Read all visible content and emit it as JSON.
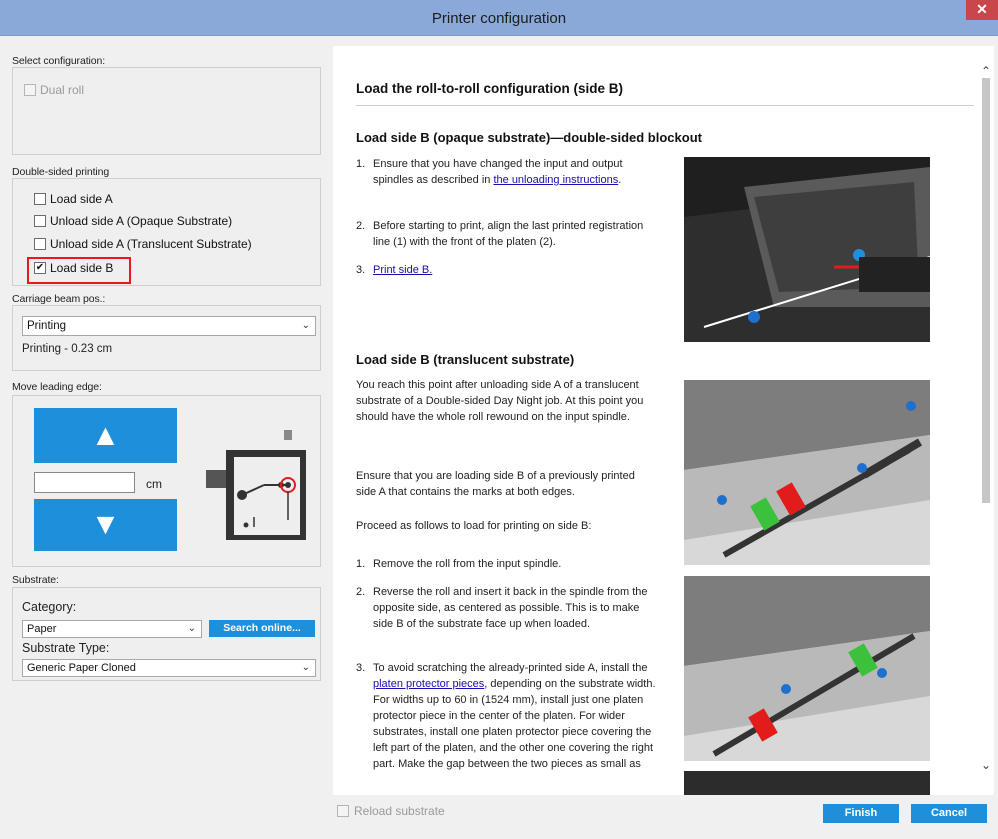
{
  "window": {
    "title": "Printer configuration",
    "close": "✕"
  },
  "left": {
    "select_configuration": {
      "label": "Select configuration:",
      "dual_roll": "Dual roll"
    },
    "double_sided": {
      "label": "Double-sided printing",
      "options": [
        {
          "label": "Load side A",
          "checked": false
        },
        {
          "label": "Unload side A (Opaque Substrate)",
          "checked": false
        },
        {
          "label": "Unload side A (Translucent Substrate)",
          "checked": false
        },
        {
          "label": "Load side B",
          "checked": true
        }
      ]
    },
    "carriage": {
      "label": "Carriage beam pos.:",
      "selected": "Printing",
      "status": "Printing - 0.23 cm"
    },
    "move_leading_edge": {
      "label": "Move leading edge:",
      "unit": "cm",
      "value": ""
    },
    "substrate": {
      "label": "Substrate:",
      "category_label": "Category:",
      "category_value": "Paper",
      "search_button": "Search online...",
      "type_label": "Substrate Type:",
      "type_value": "Generic Paper Cloned"
    }
  },
  "content": {
    "heading": "Load the roll-to-roll configuration (side B)",
    "opaque": {
      "heading": "Load side B (opaque substrate)—double-sided blockout",
      "steps": [
        {
          "n": "1.",
          "before": "Ensure that you have changed the input and output spindles as described in ",
          "link": "the unloading instructions",
          "after": "."
        },
        {
          "n": "2.",
          "text": "Before starting to print, align the last printed registration line (1) with the front of the platen (2)."
        },
        {
          "n": "3.",
          "link": "Print side B."
        }
      ]
    },
    "translucent": {
      "heading": "Load side B (translucent substrate)",
      "p1": "You reach this point after unloading side A of a translucent substrate of a Double-sided Day Night job. At this point you should have the whole roll rewound on the input spindle.",
      "p2": "Ensure that you are loading side B of a previously printed side A that contains the marks at both edges.",
      "p3": "Proceed as follows to load for printing on side B:",
      "steps": [
        {
          "n": "1.",
          "text": "Remove the roll from the input spindle."
        },
        {
          "n": "2.",
          "text": "Reverse the roll and insert it back in the spindle from the opposite side, as centered as possible. This is to make side B of the substrate face up when loaded."
        },
        {
          "n": "3.",
          "before": "To avoid scratching the already-printed side A, install the ",
          "link": "platen protector pieces",
          "after": ", depending on the substrate width. For widths up to 60 in (1524 mm), install just one platen protector piece in the center of the platen. For wider substrates, install one platen protector piece covering the left part of the platen, and the other one covering the right part. Make the gap between the two pieces as small as"
        }
      ]
    }
  },
  "footer": {
    "reload_label": "Reload substrate",
    "finish": "Finish",
    "cancel": "Cancel"
  },
  "colors": {
    "accent": "#1e8fdb",
    "highlight": "#e21b1b",
    "titlebar": "#8aa9d8"
  }
}
